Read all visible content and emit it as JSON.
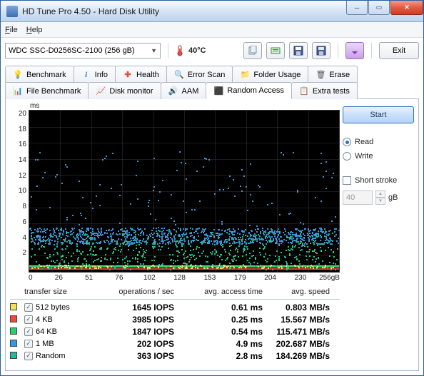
{
  "window": {
    "title": "HD Tune Pro 4.50 - Hard Disk Utility"
  },
  "menu": {
    "file": "File",
    "help": "Help"
  },
  "toolbar": {
    "drive": "WDC SSC-D0256SC-2100 (256 gB)",
    "temp": "40°C",
    "exit": "Exit"
  },
  "tabs": {
    "row1": [
      {
        "id": "benchmark",
        "label": "Benchmark"
      },
      {
        "id": "info",
        "label": "Info"
      },
      {
        "id": "health",
        "label": "Health"
      },
      {
        "id": "errorscan",
        "label": "Error Scan"
      },
      {
        "id": "folderusage",
        "label": "Folder Usage"
      },
      {
        "id": "erase",
        "label": "Erase"
      }
    ],
    "row2": [
      {
        "id": "filebench",
        "label": "File Benchmark"
      },
      {
        "id": "diskmon",
        "label": "Disk monitor"
      },
      {
        "id": "aam",
        "label": "AAM"
      },
      {
        "id": "random",
        "label": "Random Access",
        "active": true
      },
      {
        "id": "extra",
        "label": "Extra tests"
      }
    ]
  },
  "side": {
    "start": "Start",
    "read": "Read",
    "write": "Write",
    "shortstroke": "Short stroke",
    "stroke_value": "40",
    "stroke_unit": "gB"
  },
  "chart_data": {
    "type": "scatter",
    "title": "",
    "xlabel": "gB",
    "ylabel": "ms",
    "xlim": [
      0,
      256
    ],
    "ylim": [
      0,
      20
    ],
    "yticks": [
      2.0,
      4.0,
      6.0,
      8.0,
      10,
      12,
      14,
      16,
      18,
      20
    ],
    "xticks": [
      0,
      26,
      51,
      76,
      102,
      128,
      153,
      179,
      204,
      230,
      "256gB"
    ],
    "series": [
      {
        "name": "512 bytes",
        "color": "#f1e05a",
        "band_ms": 0.61
      },
      {
        "name": "4 KB",
        "color": "#e74c3c",
        "band_ms": 0.25
      },
      {
        "name": "64 KB",
        "color": "#2ecc71",
        "band_ms": 0.54
      },
      {
        "name": "1 MB",
        "color": "#3498db",
        "band_ms": 4.9
      },
      {
        "name": "Random",
        "color": "#1abc9c",
        "band_ms": 2.8
      }
    ]
  },
  "results": {
    "headers": {
      "transfer": "transfer size",
      "ops": "operations / sec",
      "acc": "avg. access time",
      "spd": "avg. speed"
    },
    "rows": [
      {
        "color": "#f1e05a",
        "name": "512 bytes",
        "ops": "1645 IOPS",
        "acc": "0.61 ms",
        "spd": "0.803 MB/s"
      },
      {
        "color": "#e74c3c",
        "name": "4 KB",
        "ops": "3985 IOPS",
        "acc": "0.25 ms",
        "spd": "15.567 MB/s"
      },
      {
        "color": "#2ecc71",
        "name": "64 KB",
        "ops": "1847 IOPS",
        "acc": "0.54 ms",
        "spd": "115.471 MB/s"
      },
      {
        "color": "#3498db",
        "name": "1 MB",
        "ops": "202 IOPS",
        "acc": "4.9 ms",
        "spd": "202.687 MB/s"
      },
      {
        "color": "#1abc9c",
        "name": "Random",
        "ops": "363 IOPS",
        "acc": "2.8 ms",
        "spd": "184.269 MB/s"
      }
    ]
  }
}
